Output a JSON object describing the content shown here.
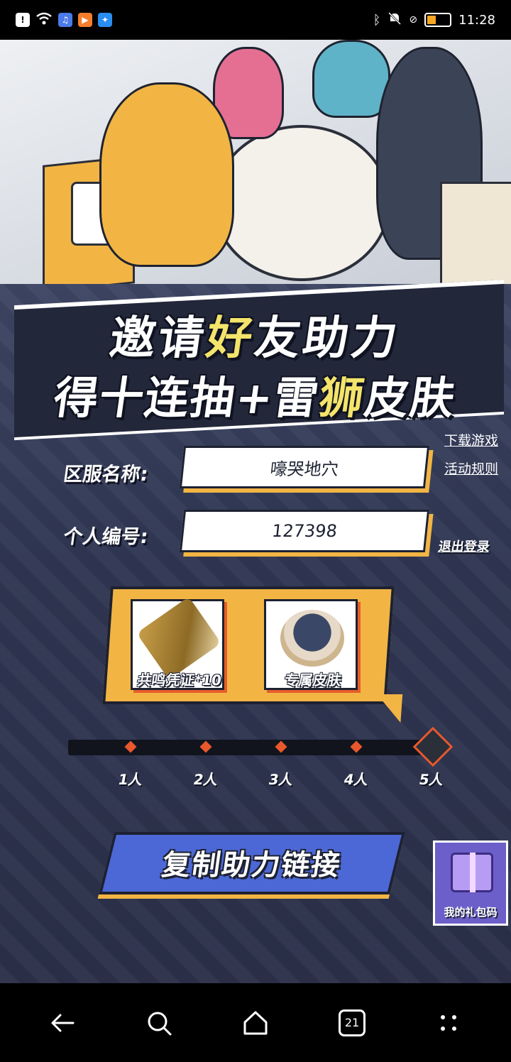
{
  "status_bar": {
    "time": "11:28",
    "battery_level": 0.4,
    "icons": [
      "alert-icon",
      "wifi-icon",
      "music-app-icon",
      "video-app-icon",
      "bulb-app-icon",
      "bluetooth-icon",
      "mute-icon",
      "no-sim-icon",
      "battery-icon"
    ]
  },
  "banner": {
    "line1_part1": "邀请",
    "line1_highlight": "好",
    "line1_part2": "友助力",
    "line2_part1": "得十连抽+雷",
    "line2_highlight": "狮",
    "line2_part2": "皮肤"
  },
  "links": {
    "download": "下载游戏",
    "rules": "活动规则",
    "logout": "退出登录"
  },
  "form": {
    "server_label": "区服名称:",
    "server_value": "嚎哭地穴",
    "id_label": "个人编号:",
    "id_value": "127398"
  },
  "rewards": [
    {
      "label": "共鸣凭证*10",
      "icon": "usb-token-icon"
    },
    {
      "label": "专属皮肤",
      "icon": "character-skin-icon"
    }
  ],
  "progress": {
    "current_count": 0,
    "steps": [
      "1人",
      "2人",
      "3人",
      "4人",
      "5人"
    ]
  },
  "cta": {
    "label": "复制助力链接"
  },
  "gift": {
    "label": "我的礼包码",
    "icon": "gift-box-icon"
  },
  "nav": {
    "tab_count": "21",
    "buttons": [
      "back-icon",
      "search-icon",
      "home-icon",
      "tabs-icon",
      "menu-icon"
    ]
  },
  "colors": {
    "accent_yellow": "#f2b544",
    "accent_orange": "#e8582c",
    "cta_blue": "#4c68d6",
    "panel_navy": "#2f3652",
    "highlight_text": "#f3e46b"
  }
}
